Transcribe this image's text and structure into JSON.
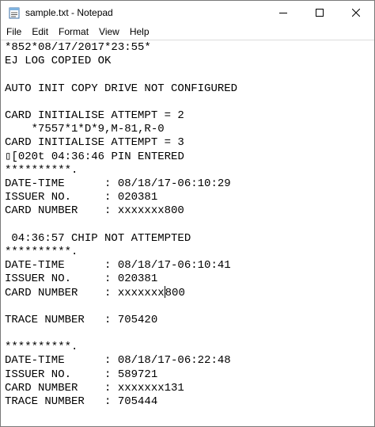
{
  "window": {
    "title": "sample.txt - Notepad",
    "icon": "notepad-icon"
  },
  "menu": [
    "File",
    "Edit",
    "Format",
    "View",
    "Help"
  ],
  "document": {
    "lines": [
      "*852*08/17/2017*23:55*",
      "EJ LOG COPIED OK",
      "",
      "AUTO INIT COPY DRIVE NOT CONFIGURED",
      "",
      "CARD INITIALISE ATTEMPT = 2",
      "    *7557*1*D*9,M-81,R-0",
      "CARD INITIALISE ATTEMPT = 3",
      "▯[020t 04:36:46 PIN ENTERED",
      "**********.",
      "DATE-TIME      : 08/18/17-06:10:29",
      "ISSUER NO.     : 020381",
      "CARD NUMBER    : xxxxxxx800",
      "",
      " 04:36:57 CHIP NOT ATTEMPTED",
      "**********.",
      "DATE-TIME      : 08/18/17-06:10:41",
      "ISSUER NO.     : 020381",
      "CARD NUMBER    : xxxxxxx|800",
      "",
      "TRACE NUMBER   : 705420",
      "",
      "**********.",
      "DATE-TIME      : 08/18/17-06:22:48",
      "ISSUER NO.     : 589721",
      "CARD NUMBER    : xxxxxxx131",
      "TRACE NUMBER   : 705444"
    ],
    "caret_line_index": 18,
    "caret_before_text": "CARD NUMBER    : xxxxxxx",
    "caret_after_text": "800"
  }
}
